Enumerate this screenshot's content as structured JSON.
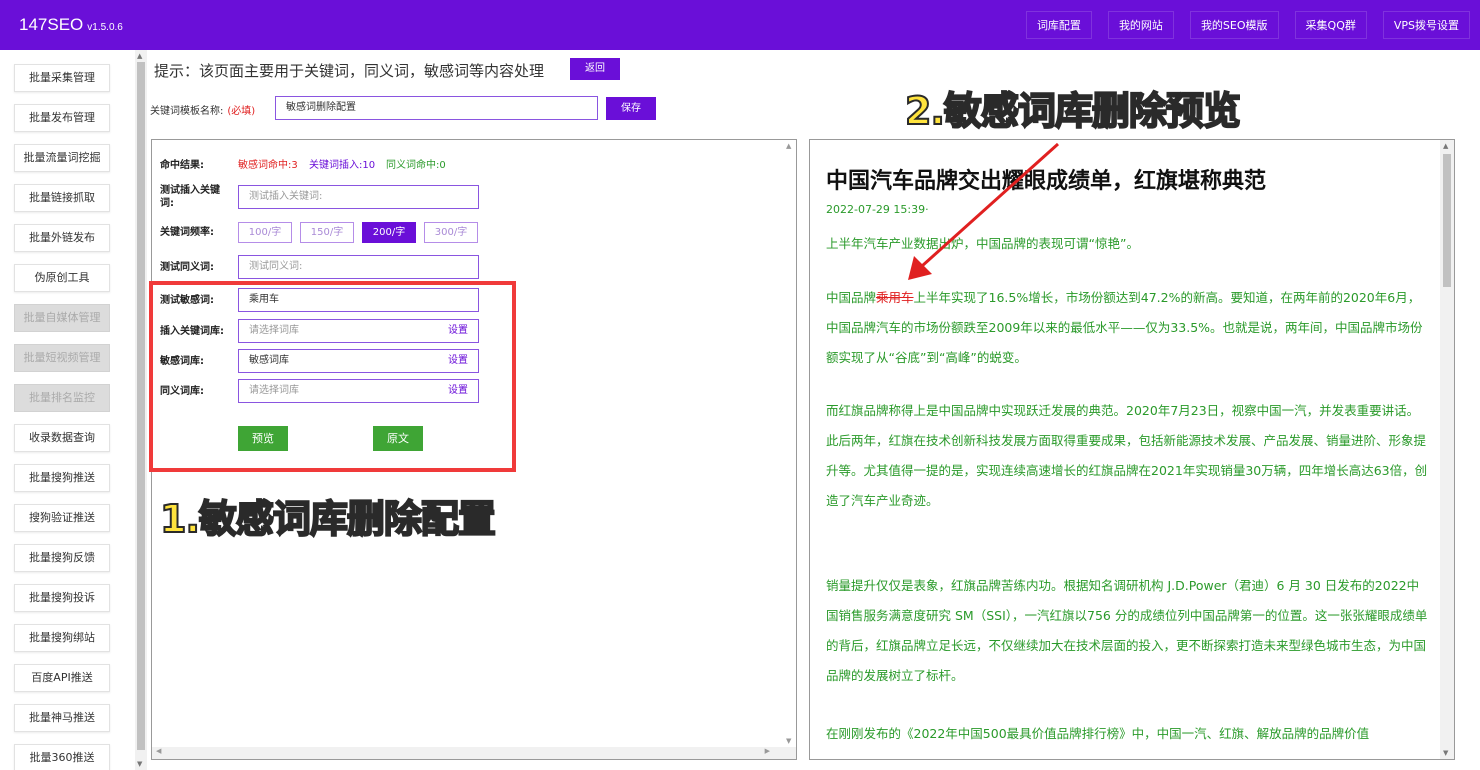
{
  "app": {
    "name": "147SEO",
    "version": "v1.5.0.6"
  },
  "topnav": [
    "词库配置",
    "我的网站",
    "我的SEO模版",
    "采集QQ群",
    "VPS拨号设置"
  ],
  "sidebar": [
    {
      "label": "批量采集管理",
      "disabled": false
    },
    {
      "label": "批量发布管理",
      "disabled": false
    },
    {
      "label": "批量流量词挖掘",
      "disabled": false
    },
    {
      "label": "批量链接抓取",
      "disabled": false
    },
    {
      "label": "批量外链发布",
      "disabled": false
    },
    {
      "label": "伪原创工具",
      "disabled": false
    },
    {
      "label": "批量自媒体管理",
      "disabled": true
    },
    {
      "label": "批量短视频管理",
      "disabled": true
    },
    {
      "label": "批量排名监控",
      "disabled": true
    },
    {
      "label": "收录数据查询",
      "disabled": false
    },
    {
      "label": "批量搜狗推送",
      "disabled": false
    },
    {
      "label": "搜狗验证推送",
      "disabled": false
    },
    {
      "label": "批量搜狗反馈",
      "disabled": false
    },
    {
      "label": "批量搜狗投诉",
      "disabled": false
    },
    {
      "label": "批量搜狗绑站",
      "disabled": false
    },
    {
      "label": "百度API推送",
      "disabled": false
    },
    {
      "label": "批量神马推送",
      "disabled": false
    },
    {
      "label": "批量360推送",
      "disabled": false
    }
  ],
  "header": {
    "hint": "提示：该页面主要用于关键词，同义词，敏感词等内容处理",
    "back_label": "返回",
    "template_label": "关键词模板名称:",
    "required": "(必填)",
    "template_value": "敏感词删除配置",
    "save_label": "保存"
  },
  "form": {
    "hit_label": "命中结果:",
    "hit_sensitive": "敏感词命中:3",
    "hit_keyword": "关键词插入:10",
    "hit_synonym": "同义词命中:0",
    "insert_kw_label": "测试插入关键词:",
    "insert_kw_placeholder": "测试插入关键词:",
    "freq_label": "关键词频率:",
    "freq_options": [
      "100/字",
      "150/字",
      "200/字",
      "300/字"
    ],
    "freq_selected": "200/字",
    "synonym_label": "测试同义词:",
    "synonym_placeholder": "测试同义词:",
    "sensitive_label": "测试敏感词:",
    "sensitive_value": "乘用车",
    "insert_lib_label": "插入关键词库:",
    "insert_lib_placeholder": "请选择词库",
    "sensitive_lib_label": "敏感词库:",
    "sensitive_lib_value": "敏感词库",
    "synonym_lib_label": "同义词库:",
    "synonym_lib_placeholder": "请选择词库",
    "set_label": "设置",
    "preview_label": "预览",
    "original_label": "原文"
  },
  "annotations": {
    "label1": "1.敏感词库删除配置",
    "label2": "2.敏感词库删除预览",
    "box_color": "#f03a3a",
    "text_color": "#ffe33d"
  },
  "preview": {
    "title": "中国汽车品牌交出耀眼成绩单，红旗堪称典范",
    "date": "2022-07-29 15:39·",
    "p1": "上半年汽车产业数据出炉，中国品牌的表现可谓“惊艳”。",
    "p2_before": "中国品牌",
    "p2_hit": "乘用车",
    "p2_after": "上半年实现了16.5%增长，市场份额达到47.2%的新高。要知道，在两年前的2020年6月，中国品牌汽车的市场份额跌至2009年以来的最低水平——仅为33.5%。也就是说，两年间，中国品牌市场份额实现了从“谷底”到“高峰”的蜕变。",
    "p3": "而红旗品牌称得上是中国品牌中实现跃迁发展的典范。2020年7月23日，视察中国一汽，并发表重要讲话。此后两年，红旗在技术创新科技发展方面取得重要成果，包括新能源技术发展、产品发展、销量进阶、形象提升等。尤其值得一提的是，实现连续高速增长的红旗品牌在2021年实现销量30万辆，四年增长高达63倍，创造了汽车产业奇迹。",
    "p4": "销量提升仅仅是表象，红旗品牌苦练内功。根据知名调研机构 J.D.Power（君迪）6 月 30 日发布的2022中国销售服务满意度研究 SM（SSI），一汽红旗以756 分的成绩位列中国品牌第一的位置。这一张张耀眼成绩单的背后，红旗品牌立足长远，不仅继续加大在技术层面的投入，更不断探索打造未来型绿色城市生态，为中国品牌的发展树立了标杆。",
    "p5": "在刚刚发布的《2022年中国500最具价值品牌排行榜》中，中国一汽、红旗、解放品牌的品牌价值",
    "text_color": "#2a9a2a",
    "hit_color": "#e02020"
  }
}
